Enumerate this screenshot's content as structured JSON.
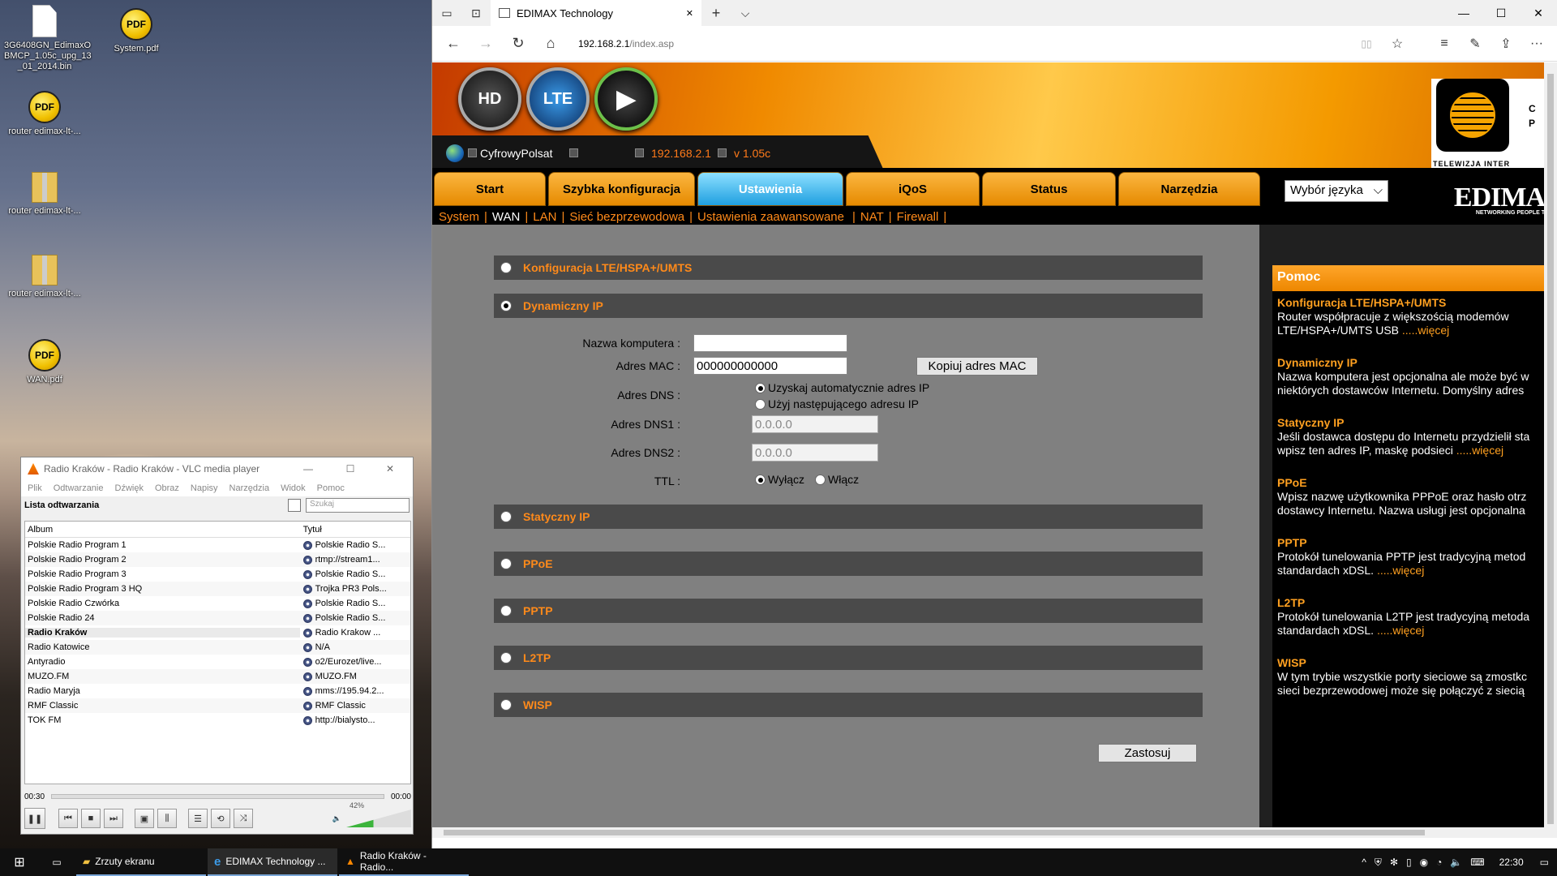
{
  "desktop": {
    "icons": [
      {
        "label": "3G6408GN_EdimaxO BMCP_1.05c_upg_13 _01_2014.bin",
        "type": "file"
      },
      {
        "label": "System.pdf",
        "type": "pdf"
      },
      {
        "label": "router edimax-lt-...",
        "type": "pdf"
      },
      {
        "label": "router edimax-lt-...",
        "type": "zip"
      },
      {
        "label": "router edimax-lt-...",
        "type": "zip"
      },
      {
        "label": "WAN.pdf",
        "type": "pdf"
      }
    ],
    "pdf_glyph": "PDF"
  },
  "browser": {
    "tab_title": "EDIMAX Technology",
    "url_host": "192.168.2.1",
    "url_path": "/index.asp",
    "icons": {
      "tab_preview": "▭",
      "back_tab": "⊡",
      "close_tab": "✕",
      "new_tab": "+",
      "tab_list": "⌵",
      "minimize": "—",
      "maximize": "☐",
      "close": "✕",
      "back": "←",
      "forward": "→",
      "refresh": "↻",
      "home": "⌂",
      "reading": "▯▯",
      "favorite": "☆",
      "hub": "≡",
      "note": "✎",
      "share": "⇪",
      "more": "···"
    }
  },
  "router": {
    "circle_buttons": [
      "HD",
      "LTE",
      "▶"
    ],
    "provider": "CyfrowyPolsat",
    "ip": "192.168.2.1",
    "version": "v 1.05c",
    "logo_text": "TELEWIZJA  INTER",
    "logo_side": "C\nP",
    "brand": "EDIMA",
    "brand_sub": "NETWORKING PEOPLE T",
    "nav_tabs": [
      "Start",
      "Szybka konfiguracja",
      "Ustawienia",
      "iQoS",
      "Status",
      "Narzędzia"
    ],
    "active_tab": "Ustawienia",
    "language_label": "Wybór języka",
    "subnav": [
      "System",
      "WAN",
      "LAN",
      "Sieć bezprzewodowa",
      "Ustawienia zaawansowane",
      "NAT",
      "Firewall"
    ],
    "subnav_current": "WAN",
    "sections": [
      {
        "label": "Konfiguracja LTE/HSPA+/UMTS",
        "selected": false
      },
      {
        "label": "Dynamiczny IP",
        "selected": true
      },
      {
        "label": "Statyczny IP",
        "selected": false
      },
      {
        "label": "PPoE",
        "selected": false
      },
      {
        "label": "PPTP",
        "selected": false
      },
      {
        "label": "L2TP",
        "selected": false
      },
      {
        "label": "WISP",
        "selected": false
      }
    ],
    "form": {
      "hostname_label": "Nazwa komputera :",
      "hostname_value": "",
      "mac_label": "Adres MAC :",
      "mac_value": "000000000000",
      "copy_mac": "Kopiuj adres MAC",
      "dns_label": "Adres DNS :",
      "dns_auto": "Uzyskaj automatycznie adres IP",
      "dns_manual": "Użyj następującego adresu IP",
      "dns1_label": "Adres DNS1 :",
      "dns1_value": "0.0.0.0",
      "dns2_label": "Adres DNS2 :",
      "dns2_value": "0.0.0.0",
      "ttl_label": "TTL :",
      "ttl_off": "Wyłącz",
      "ttl_on": "Włącz",
      "apply": "Zastosuj"
    },
    "help": {
      "title": "Pomoc",
      "items": [
        {
          "heading": "Konfiguracja LTE/HSPA+/UMTS",
          "lines": [
            "Router współpracuje z większością modemów",
            "LTE/HSPA+/UMTS USB"
          ],
          "more": ".....więcej"
        },
        {
          "heading": "Dynamiczny IP",
          "lines": [
            "Nazwa komputera jest opcjonalna ale może być w",
            "niektórych dostawców Internetu. Domyślny adres"
          ],
          "more": ""
        },
        {
          "heading": "Statyczny IP",
          "lines": [
            "Jeśli dostawca dostępu do Internetu przydzielił sta",
            "wpisz ten adres IP, maskę podsieci"
          ],
          "more": ".....więcej"
        },
        {
          "heading": "PPoE",
          "lines": [
            "Wpisz nazwę użytkownika PPPoE oraz hasło otrz",
            "dostawcy Internetu. Nazwa usługi jest opcjonalna"
          ],
          "more": ""
        },
        {
          "heading": "PPTP",
          "lines": [
            "Protokół tunelowania PPTP jest tradycyjną metod",
            "standardach xDSL."
          ],
          "more": ".....więcej"
        },
        {
          "heading": "L2TP",
          "lines": [
            "Protokół tunelowania L2TP jest tradycyjną metoda",
            "standardach xDSL."
          ],
          "more": ".....więcej"
        },
        {
          "heading": "WISP",
          "lines": [
            "W tym trybie wszystkie porty sieciowe są zmostkc",
            "sieci bezprzewodowej może się połączyć z siecią"
          ],
          "more": ""
        }
      ]
    }
  },
  "vlc": {
    "title": "Radio Kraków - Radio Kraków - VLC media player",
    "menu": [
      "Plik",
      "Odtwarzanie",
      "Dźwięk",
      "Obraz",
      "Napisy",
      "Narzędzia",
      "Widok",
      "Pomoc"
    ],
    "playlist_label": "Lista odtwarzania",
    "search_placeholder": "Szukaj",
    "col_album": "Album",
    "col_title": "Tytuł",
    "rows": [
      {
        "album": "Polskie Radio Program 1",
        "title": "Polskie Radio S..."
      },
      {
        "album": "Polskie Radio Program 2",
        "title": "rtmp://stream1..."
      },
      {
        "album": "Polskie Radio Program 3",
        "title": "Polskie Radio S..."
      },
      {
        "album": "Polskie Radio Program 3 HQ",
        "title": "Trojka PR3 Pols..."
      },
      {
        "album": "Polskie Radio Czwórka",
        "title": "Polskie Radio S..."
      },
      {
        "album": "Polskie Radio 24",
        "title": "Polskie Radio S..."
      },
      {
        "album": "Radio Kraków",
        "title": "Radio Krakow ..."
      },
      {
        "album": "Radio Katowice",
        "title": "N/A"
      },
      {
        "album": "Antyradio",
        "title": "o2/Eurozet/live..."
      },
      {
        "album": "MUZO.FM",
        "title": "MUZO.FM"
      },
      {
        "album": "Radio Maryja",
        "title": "mms://195.94.2..."
      },
      {
        "album": "RMF Classic",
        "title": "RMF Classic"
      },
      {
        "album": "TOK FM",
        "title": "http://bialysto..."
      }
    ],
    "playing_index": 6,
    "time_elapsed": "00:30",
    "time_total": "00:00",
    "volume_percent": 42,
    "volume_label": "42%",
    "icons": {
      "pause": "❚❚",
      "prev": "⏮",
      "stop": "■",
      "next": "⏭",
      "fullscreen": "▣",
      "eq": "⫼",
      "playlist": "☰",
      "loop": "⟲",
      "shuffle": "⤨",
      "speaker": "🔈",
      "minimize": "—",
      "maximize": "☐",
      "close": "✕"
    }
  },
  "taskbar": {
    "start_icon": "⊞",
    "taskview_icon": "▭",
    "items": [
      "Zrzuty ekranu",
      "EDIMAX Technology ...",
      "Radio Kraków - Radio..."
    ],
    "item_icons": [
      "▰",
      "e",
      "▲"
    ],
    "tray_icons": [
      "^",
      "⛨",
      "✻",
      "▯",
      "◉",
      "◔",
      "🔈",
      "⌨"
    ],
    "clock": "22:30",
    "notif_icon": "▭"
  }
}
